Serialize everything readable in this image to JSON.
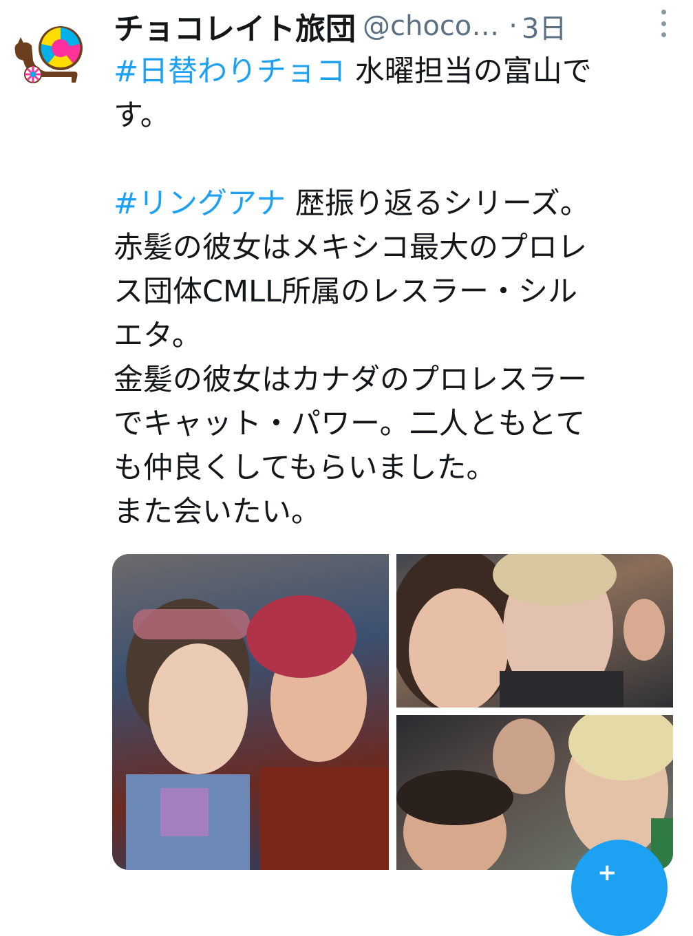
{
  "tweet": {
    "display_name": "チョコレイト旅団",
    "handle": "@choco…",
    "separator": "·",
    "time": "3日",
    "lines": [
      {
        "hashtag": "#日替わりチョコ",
        "text": " 水曜担当の富山で"
      },
      {
        "hashtag": "",
        "text": "す。"
      },
      {
        "hashtag": "",
        "text": ""
      },
      {
        "hashtag": "#リングアナ",
        "text": " 歴振り返るシリーズ。"
      },
      {
        "hashtag": "",
        "text": "赤髪の彼女はメキシコ最大のプロレ"
      },
      {
        "hashtag": "",
        "text": "ス団体CMLL所属のレスラー・シル"
      },
      {
        "hashtag": "",
        "text": "エタ。"
      },
      {
        "hashtag": "",
        "text": "金髪の彼女はカナダのプロレスラー"
      },
      {
        "hashtag": "",
        "text": "でキャット・パワー。二人ともとて"
      },
      {
        "hashtag": "",
        "text": "も仲良くしてもらいました。"
      },
      {
        "hashtag": "",
        "text": "また会いたい。"
      }
    ]
  },
  "icons": {
    "avatar": "chocolate-cart-logo",
    "more": "vertical-dots-icon",
    "compose": "compose-tweet-icon"
  },
  "colors": {
    "hashtag": "#1da1f2",
    "secondary_text": "#5b7083",
    "fab": "#1da1f2"
  },
  "fab": {
    "label": "+"
  }
}
